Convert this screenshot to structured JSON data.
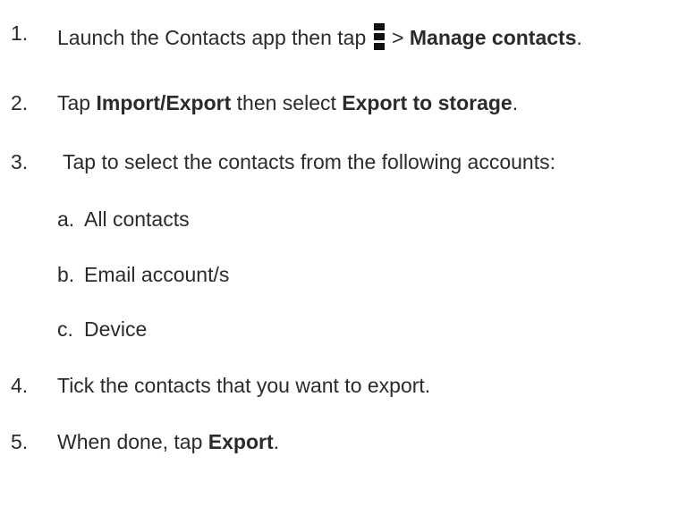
{
  "steps": [
    {
      "number": "1.",
      "before": "Launch the Contacts app then tap ",
      "icon": "more-options-icon",
      "after": " > ",
      "bold": "Manage contacts",
      "end": "."
    },
    {
      "number": "2.",
      "before": "Tap ",
      "bold1": "Import/Export",
      "middle": " then select ",
      "bold2": "Export to storage",
      "end": "."
    },
    {
      "number": "3.",
      "text": " Tap to select the contacts from the following accounts:"
    },
    {
      "number": "4.",
      "text": "Tick the contacts that you want to export."
    },
    {
      "number": "5.",
      "before": "When done, tap ",
      "bold": "Export",
      "end": "."
    }
  ],
  "substeps": [
    {
      "letter": "a.",
      "text": "All contacts"
    },
    {
      "letter": "b.",
      "text": "Email account/s"
    },
    {
      "letter": "c.",
      "text": "Device"
    }
  ]
}
